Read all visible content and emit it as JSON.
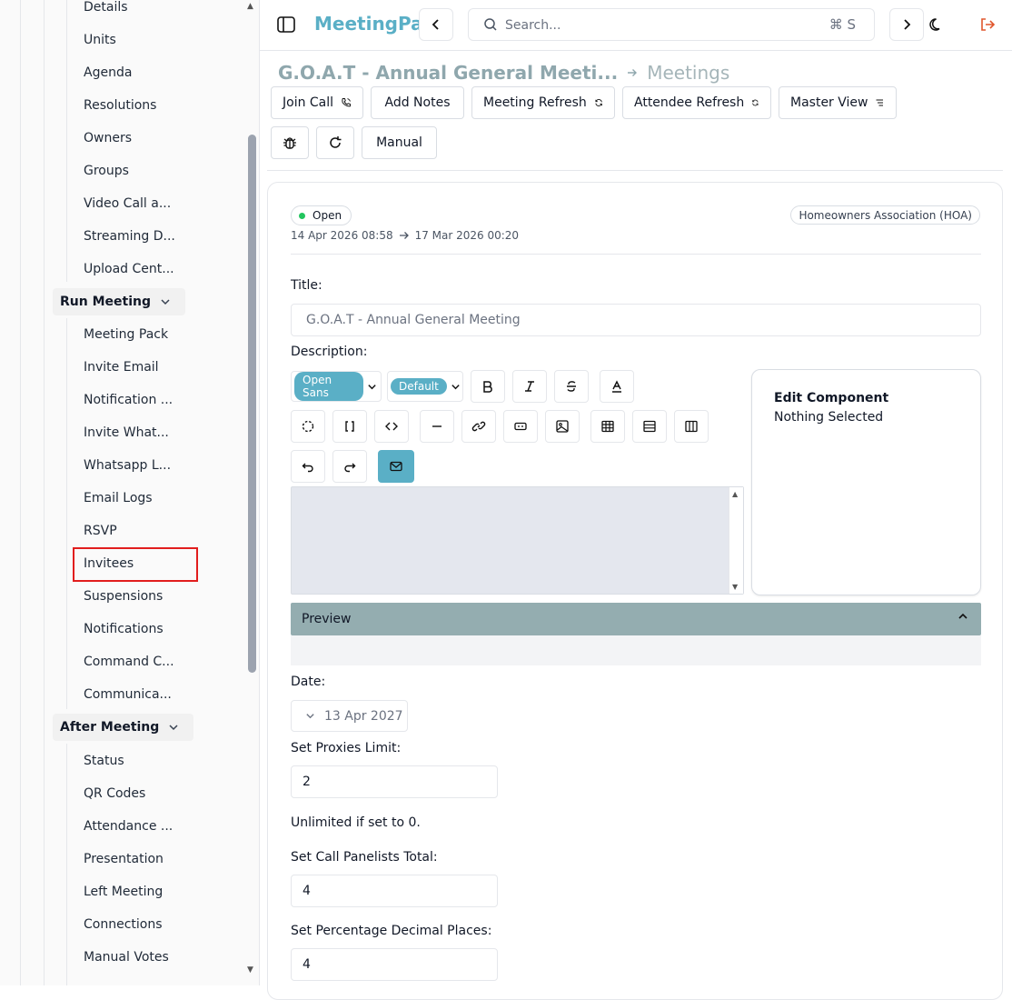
{
  "app": {
    "title": "MeetingPal",
    "search_placeholder": "Search...",
    "search_shortcut": "⌘ S"
  },
  "sidebar": {
    "top_items": [
      "Details",
      "Units",
      "Agenda",
      "Resolutions",
      "Owners",
      "Groups",
      "Video Call a...",
      "Streaming D...",
      "Upload Cent..."
    ],
    "run_meeting": {
      "label": "Run Meeting",
      "items": [
        "Meeting Pack",
        "Invite Email",
        "Notification ...",
        "Invite What...",
        "Whatsapp L...",
        "Email Logs",
        "RSVP",
        "Invitees",
        "Suspensions",
        "Notifications",
        "Command C...",
        "Communica..."
      ]
    },
    "after_meeting": {
      "label": "After Meeting",
      "items": [
        "Status",
        "QR Codes",
        "Attendance ...",
        "Presentation",
        "Left Meeting",
        "Connections",
        "Manual Votes"
      ]
    },
    "highlighted_item": "Invitees"
  },
  "breadcrumb": {
    "current": "G.O.A.T - Annual General Meeti...",
    "parent": "Meetings"
  },
  "toolbar": {
    "join_call": "Join Call",
    "add_notes": "Add Notes",
    "meeting_refresh": "Meeting Refresh",
    "attendee_refresh": "Attendee Refresh",
    "master_view": "Master View",
    "manual": "Manual"
  },
  "meeting": {
    "status": "Open",
    "start": "14 Apr 2026 08:58",
    "end": "17 Mar 2026 00:20",
    "association": "Homeowners Association (HOA)"
  },
  "form": {
    "title_label": "Title:",
    "title_value": "G.O.A.T - Annual General Meeting",
    "description_label": "Description:",
    "font_family": "Open Sans",
    "font_size": "Default",
    "edit_component_heading": "Edit Component",
    "edit_component_text": "Nothing Selected",
    "preview_label": "Preview",
    "date_label": "Date:",
    "date_value": "13 Apr 2027",
    "proxies_label": "Set Proxies Limit:",
    "proxies_value": "2",
    "proxies_note": "Unlimited if set to 0.",
    "panelists_label": "Set Call Panelists Total:",
    "panelists_value": "4",
    "decimal_label": "Set Percentage Decimal Places:",
    "decimal_value": "4"
  },
  "colors": {
    "brand": "#5aafc6",
    "preview_bar": "#94adb0",
    "status_open": "#22c55e",
    "highlight": "#e11d1d",
    "logout": "#e0572d"
  }
}
